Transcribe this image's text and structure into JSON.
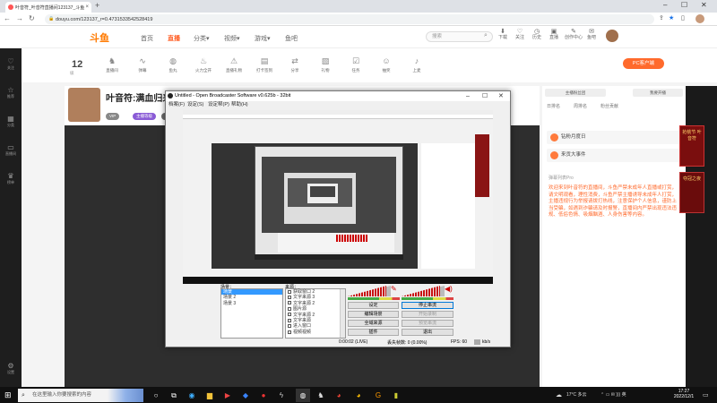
{
  "browser": {
    "tab_title": "叶音符_叶音符直播间123137_斗鱼",
    "tab_close": "×",
    "new_tab": "+",
    "url": "douyu.com/123137_r=0.4731533542528419",
    "win": {
      "min": "–",
      "max": "☐",
      "close": "✕"
    },
    "nav": {
      "back": "←",
      "forward": "→",
      "reload": "↻"
    }
  },
  "site": {
    "logo": "斗鱼",
    "nav": [
      "首页",
      "直播",
      "分类▾",
      "视频▾",
      "游戏▾",
      "鱼吧"
    ],
    "nav_active_index": 1,
    "search_placeholder": "搜索",
    "header_icons": [
      "下载",
      "关注",
      "历史",
      "直播",
      "创作中心",
      "鱼吧"
    ],
    "sidebar": [
      "关注",
      "推荐",
      "分类",
      "直播间",
      "榜单",
      "设置"
    ],
    "level": "12",
    "level_sub": "级",
    "gifts": [
      "直播间",
      "弹幕",
      "鱼丸",
      "火力全开",
      "直播礼物",
      "打卡签到",
      "分享",
      "礼物",
      "任务",
      "抽奖",
      "上麦"
    ],
    "pc_button": "PC客户端",
    "room_title": "叶音符:满血归来，开",
    "tags": [
      "VIP",
      "主播等级",
      "粉丝团"
    ],
    "right_buttons": [
      "主播粉丝团",
      "我要开播"
    ],
    "right_tabs": [
      "日排名",
      "周排名",
      "粉丝贡献"
    ],
    "cards": [
      "钻粉月度日",
      "来贡大事件"
    ],
    "chat_head": "弹幕列表Pro",
    "chat_text": "欢迎来到叶音符的直播间，斗鱼严禁未成年人直播或打赏，请文明观看，理性消费，斗鱼严禁主播诱导未成年人打赏，主播违规行为举报请拨打热线，注意保护个人信息，谨防上当受骗，如遇到诈骗请及时报警，直播间内严禁出现违法违规、低俗色情、吸烟酗酒、人身伤害等内容。",
    "ad1": "抢桃节 叶音符",
    "ad2": "夺冠之夜"
  },
  "obs": {
    "title": "Untitled - Open Broadcaster Software v0.625b - 32bit",
    "menu": [
      "档案(F)",
      "设定(S)",
      "设定帮(P)",
      "帮助(H)"
    ],
    "scenes_label": "场景：",
    "sources_label": "来源：",
    "scenes": [
      "场景",
      "场景 2",
      "场景 3"
    ],
    "sources": [
      "获取窗口 2",
      "文字来源 3",
      "文字来源 2",
      "图片源",
      "文字来源 2",
      "文字来源",
      "进入窗口",
      "视频视频",
      "全屏获取"
    ],
    "volume": {
      "mic": 0.9,
      "desktop": 0.9
    },
    "buttons": [
      "设定",
      "停止串流",
      "编辑场景",
      "开始录制",
      "全域来源",
      "预览串流",
      "插件",
      "退出"
    ],
    "disabled_buttons": [
      "开始录制",
      "预览串流"
    ],
    "status_time": "0:00:02 (LIVE)",
    "status_dropped": "丢失帧数: 0 (0.00%)",
    "status_fps": "FPS: 60",
    "status_kbps": "kb/s"
  },
  "taskbar": {
    "start": "⊞",
    "search_placeholder": "在这里输入你要搜索的内容",
    "tray_temp": "17°C 多云",
    "tray_icons": "⌃  ▭  ✉  )))  英",
    "time": "17:27",
    "date": "2022/12/1"
  }
}
